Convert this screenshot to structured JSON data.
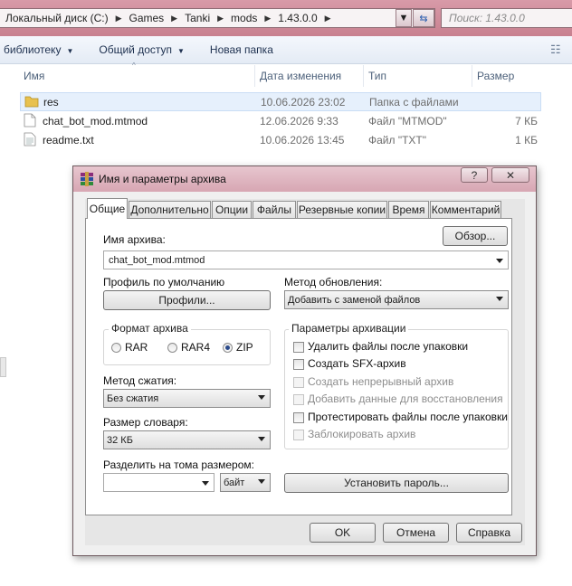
{
  "explorer": {
    "breadcrumb": [
      "Локальный диск (C:)",
      "Games",
      "Tanki",
      "mods",
      "1.43.0.0"
    ],
    "search_placeholder": "Поиск: 1.43.0.0",
    "toolbar": [
      "библиотеку",
      "Общий доступ",
      "Новая папка"
    ],
    "columns": {
      "name": "Имя",
      "date": "Дата изменения",
      "type": "Тип",
      "size": "Размер"
    },
    "files": [
      {
        "name": "res",
        "date": "10.06.2026 23:02",
        "type": "Папка с файлами",
        "size": "",
        "icon": "folder-icon"
      },
      {
        "name": "chat_bot_mod.mtmod",
        "date": "12.06.2026 9:33",
        "type": "Файл \"MTMOD\"",
        "size": "7 КБ",
        "icon": "file-icon"
      },
      {
        "name": "readme.txt",
        "date": "10.06.2026 13:45",
        "type": "Файл \"TXT\"",
        "size": "1 КБ",
        "icon": "text-file-icon"
      }
    ]
  },
  "dialog": {
    "title": "Имя и параметры архива",
    "help": "?",
    "close": "✕",
    "tabs": [
      "Общие",
      "Дополнительно",
      "Опции",
      "Файлы",
      "Резервные копии",
      "Время",
      "Комментарий"
    ],
    "archive_name_label": "Имя архива:",
    "browse_button": "Обзор...",
    "archive_name_value": "chat_bot_mod.mtmod",
    "profile_label": "Профиль по умолчанию",
    "profiles_button": "Профили...",
    "update_method_label": "Метод обновления:",
    "update_method_value": "Добавить с заменой файлов",
    "format_group": "Формат архива",
    "formats": [
      "RAR",
      "RAR4",
      "ZIP"
    ],
    "selected_format": "ZIP",
    "compression_label": "Метод сжатия:",
    "compression_value": "Без сжатия",
    "dict_label": "Размер словаря:",
    "dict_value": "32 КБ",
    "split_label": "Разделить на тома размером:",
    "split_value": "",
    "split_unit": "байт",
    "params_group": "Параметры архивации",
    "options": [
      {
        "label": "Удалить файлы после упаковки",
        "enabled": true,
        "checked": false
      },
      {
        "label": "Создать SFX-архив",
        "enabled": true,
        "checked": false
      },
      {
        "label": "Создать непрерывный архив",
        "enabled": false,
        "checked": false
      },
      {
        "label": "Добавить данные для восстановления",
        "enabled": false,
        "checked": false
      },
      {
        "label": "Протестировать файлы после упаковки",
        "enabled": true,
        "checked": false
      },
      {
        "label": "Заблокировать архив",
        "enabled": false,
        "checked": false
      }
    ],
    "password_button": "Установить пароль...",
    "ok": "OK",
    "cancel": "Отмена",
    "help_button": "Справка"
  }
}
